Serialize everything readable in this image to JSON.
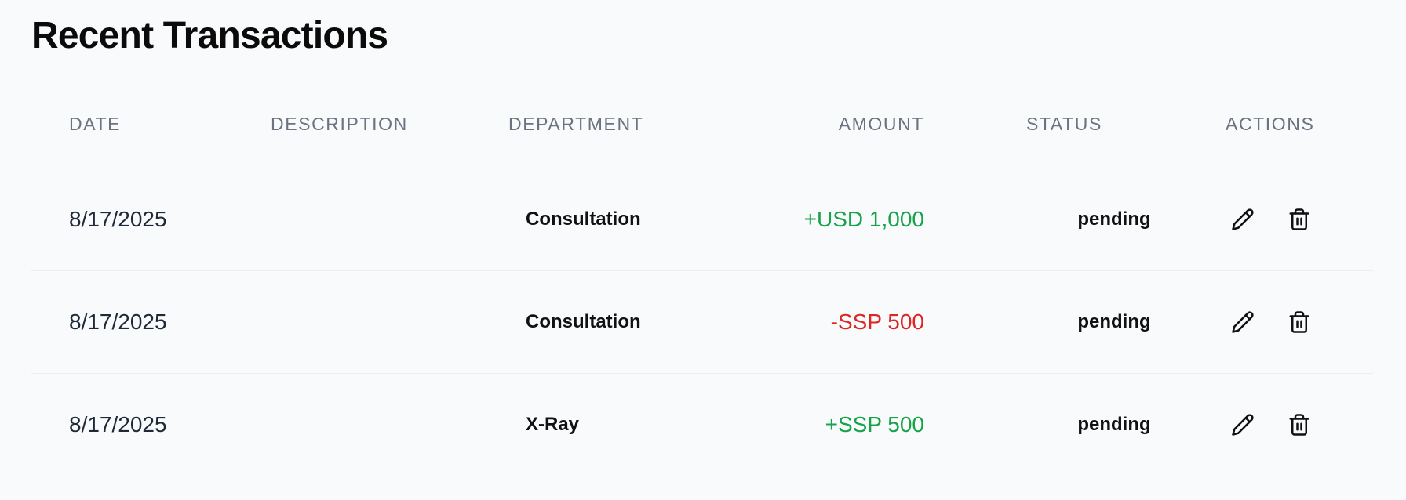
{
  "page": {
    "title": "Recent Transactions"
  },
  "table": {
    "headers": {
      "date": "DATE",
      "description": "DESCRIPTION",
      "department": "DEPARTMENT",
      "amount": "AMOUNT",
      "status": "STATUS",
      "actions": "ACTIONS"
    },
    "rows": [
      {
        "date": "8/17/2025",
        "description": "",
        "department": "Consultation",
        "amount": "+USD 1,000",
        "amount_type": "credit",
        "status": "pending"
      },
      {
        "date": "8/17/2025",
        "description": "",
        "department": "Consultation",
        "amount": "-SSP 500",
        "amount_type": "debit",
        "status": "pending"
      },
      {
        "date": "8/17/2025",
        "description": "",
        "department": "X-Ray",
        "amount": "+SSP 500",
        "amount_type": "credit",
        "status": "pending"
      }
    ]
  },
  "icons": {
    "edit": "pencil-icon",
    "delete": "trash-icon"
  },
  "colors": {
    "credit": "#16a34a",
    "debit": "#dc2626",
    "header_text": "#6b7280",
    "background": "#f9fafb"
  }
}
